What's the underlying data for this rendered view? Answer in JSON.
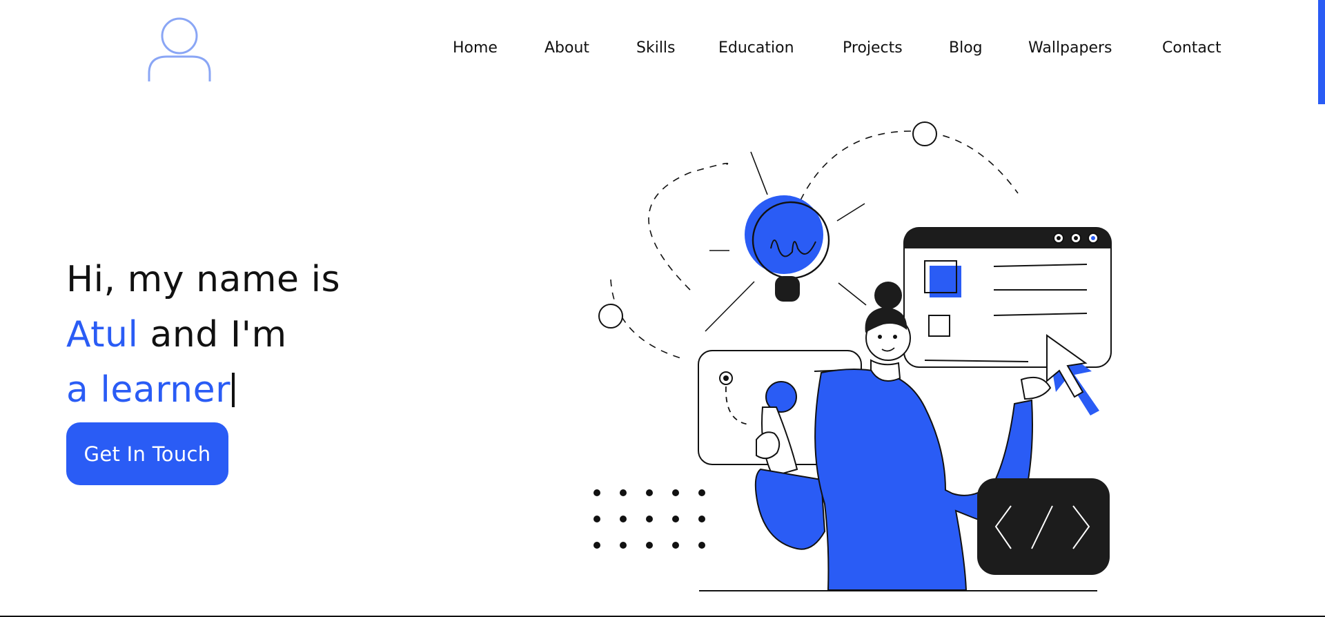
{
  "logo": {
    "icon": "user-icon"
  },
  "nav": {
    "items": [
      {
        "label": "Home"
      },
      {
        "label": "About"
      },
      {
        "label": "Skills"
      },
      {
        "label": "Education"
      },
      {
        "label": "Projects"
      },
      {
        "label": "Blog"
      },
      {
        "label": "Wallpapers"
      },
      {
        "label": "Contact"
      }
    ]
  },
  "hero": {
    "line1": "Hi, my name is",
    "name": "Atul",
    "line2_rest": " and I'm",
    "typed_text": "a learner",
    "cta_label": "Get In Touch"
  },
  "illustration": {
    "code_icon": "code-brackets-icon"
  },
  "colors": {
    "accent": "#2a5cf5",
    "dark": "#1c1c1c",
    "text": "#111111"
  }
}
